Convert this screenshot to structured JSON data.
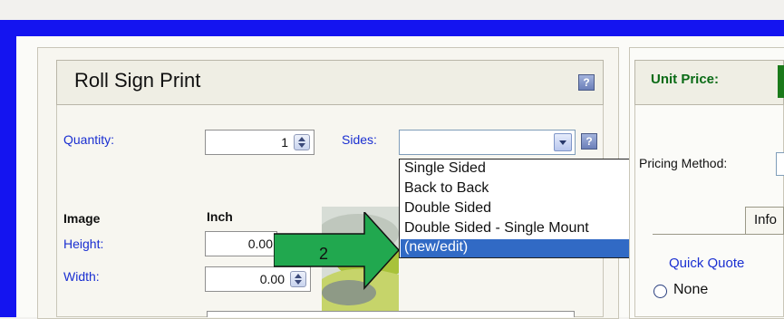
{
  "product": {
    "title": "Roll Sign Print"
  },
  "fields": {
    "quantity_label": "Quantity:",
    "quantity_value": "1",
    "sides_label": "Sides:",
    "sides_value": "",
    "image_label": "Image",
    "unit_header": "Inch",
    "height_label": "Height:",
    "height_value": "0.00",
    "width_label": "Width:",
    "width_value": "0.00"
  },
  "sides_options": [
    "Single Sided",
    "Back to Back",
    "Double Sided",
    "Double Sided - Single Mount"
  ],
  "sides_selected_option": "(new/edit)",
  "right_panel": {
    "unit_price_label": "Unit Price:",
    "pricing_method_label": "Pricing Method:",
    "tab_label": "Info",
    "quick_quote_label": "Quick Quote",
    "radio_none_label": "None"
  },
  "annotation": {
    "step_number": "2",
    "color": "#21a84f"
  },
  "colors": {
    "frame_blue": "#1414f0",
    "label_blue": "#1a2fd1",
    "highlight": "#316ac5",
    "price_green": "#0a6b16"
  },
  "icons": [
    "help-icon",
    "spinner-icon",
    "dropdown-arrow-icon",
    "radio-icon",
    "arrow-callout-icon"
  ]
}
